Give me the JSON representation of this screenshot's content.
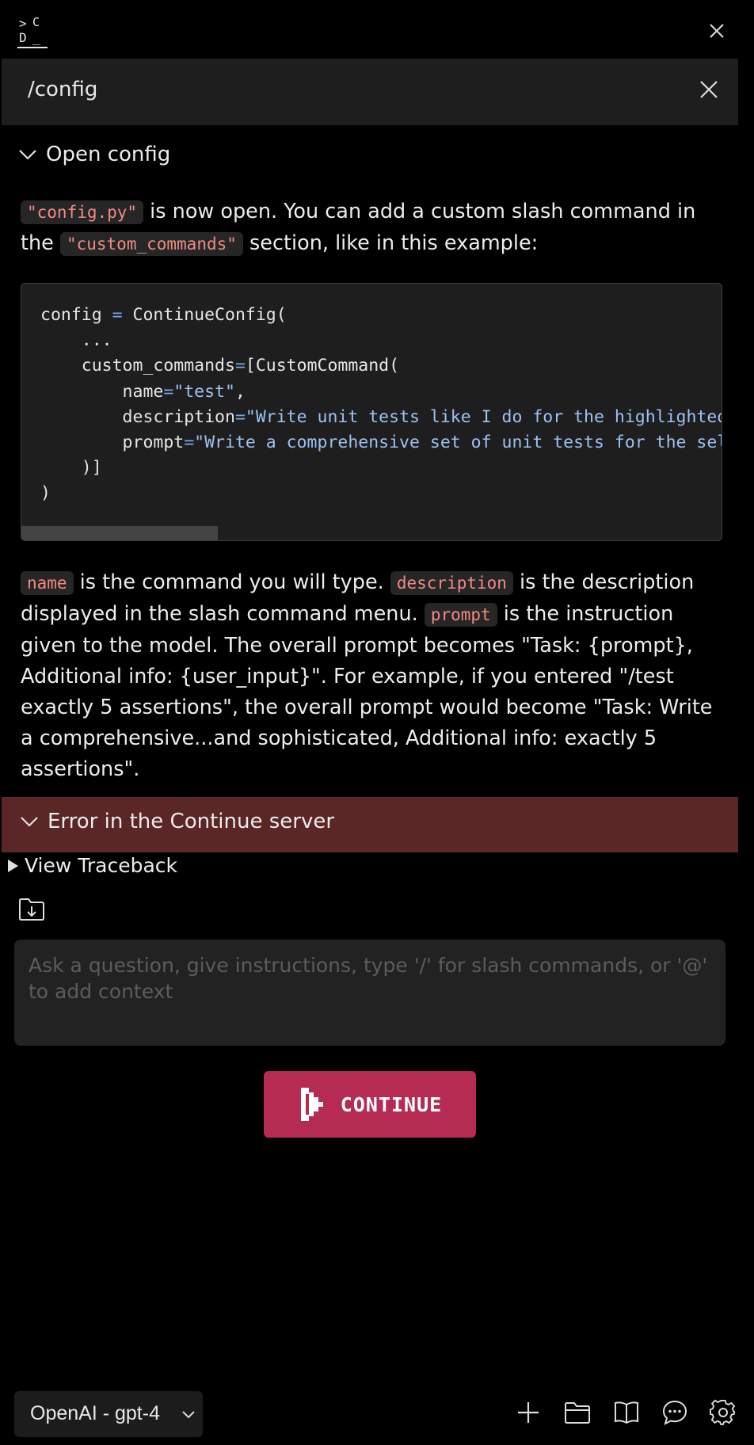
{
  "header": {
    "logo_text": ">C D_",
    "close_icon": "close-icon"
  },
  "command": {
    "text": "/config",
    "close_icon": "close-icon"
  },
  "open_config": {
    "title": "Open config",
    "intro": {
      "code1": "\"config.py\"",
      "text1": " is now open. You can add a custom slash command in the ",
      "code2": "\"custom_commands\"",
      "text2": " section, like in this example:"
    },
    "code_lines": [
      "config = ContinueConfig(",
      "    ...",
      "    custom_commands=[CustomCommand(",
      "        name=\"test\",",
      "        description=\"Write unit tests like I do for the highlighted code\",",
      "        prompt=\"Write a comprehensive set of unit tests for the selected code\",",
      "    )]",
      ")"
    ],
    "explanation": {
      "code_name": "name",
      "text1": " is the command you will type. ",
      "code_description": "description",
      "text2": " is the description displayed in the slash command menu. ",
      "code_prompt": "prompt",
      "text3": " is the instruction given to the model. The overall prompt becomes \"Task: {prompt}, Additional info: {user_input}\". For example, if you entered \"/test exactly 5 assertions\", the overall prompt would become \"Task: Write a comprehensive...and sophisticated, Additional info: exactly 5 assertions\"."
    }
  },
  "error": {
    "title": "Error in the Continue server",
    "traceback_label": "View Traceback"
  },
  "input": {
    "placeholder": "Ask a question, give instructions, type '/' for slash commands, or '@' to add context",
    "value": ""
  },
  "continue_button": {
    "label": "CONTINUE"
  },
  "footer": {
    "model": "OpenAI - gpt-4",
    "icons": [
      "plus-icon",
      "folder-icon",
      "book-icon",
      "chat-bubble-icon",
      "gear-icon"
    ]
  },
  "colors": {
    "background": "#000000",
    "panel": "#1e1e1e",
    "error_bar": "#5a2626",
    "continue_button": "#b52b52",
    "inline_code": "#f28b82",
    "code_string": "#9cc2f2"
  }
}
